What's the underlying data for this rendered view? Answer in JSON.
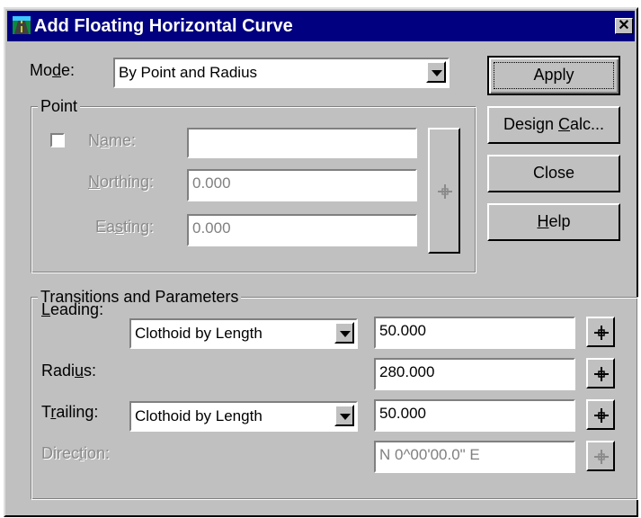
{
  "window": {
    "title": "Add Floating Horizontal Curve",
    "close_glyph": "✕"
  },
  "mode": {
    "label_pre": "Mo",
    "label_u": "d",
    "label_post": "e:",
    "selected": "By Point and Radius"
  },
  "buttons": {
    "apply": "Apply",
    "design_calc_pre": "Design ",
    "design_calc_u": "C",
    "design_calc_post": "alc...",
    "close": "Close",
    "help_u": "H",
    "help_post": "elp"
  },
  "point_group": {
    "title": "Point",
    "name_label_pre": "N",
    "name_label_u": "a",
    "name_label_post": "me:",
    "name_value": "",
    "northing_label_u": "N",
    "northing_label_post": "orthing:",
    "northing_value": "0.000",
    "easting_label_pre": "Ea",
    "easting_label_u": "s",
    "easting_label_post": "ting:",
    "easting_value": "0.000"
  },
  "transitions_group": {
    "title": "Transitions and Parameters",
    "leading_label_u": "L",
    "leading_label_post": "eading:",
    "leading_type": "Clothoid by Length",
    "leading_value": "50.000",
    "radius_label_pre": "Radi",
    "radius_label_u": "u",
    "radius_label_post": "s:",
    "radius_value": "280.000",
    "trailing_label_pre": "T",
    "trailing_label_u": "r",
    "trailing_label_post": "ailing:",
    "trailing_type": "Clothoid by Length",
    "trailing_value": "50.000",
    "direction_label_pre": "Direc",
    "direction_label_u": "t",
    "direction_label_post": "ion:",
    "direction_value": "N 0^00'00.0\" E"
  },
  "icons": {
    "app": "road-app-icon",
    "pick": "crosshair-pick-icon",
    "dropdown": "chevron-down-icon"
  },
  "colors": {
    "titlebar": "#000080",
    "face": "#c0c0c0",
    "disabled_text": "#8a8a8a"
  }
}
